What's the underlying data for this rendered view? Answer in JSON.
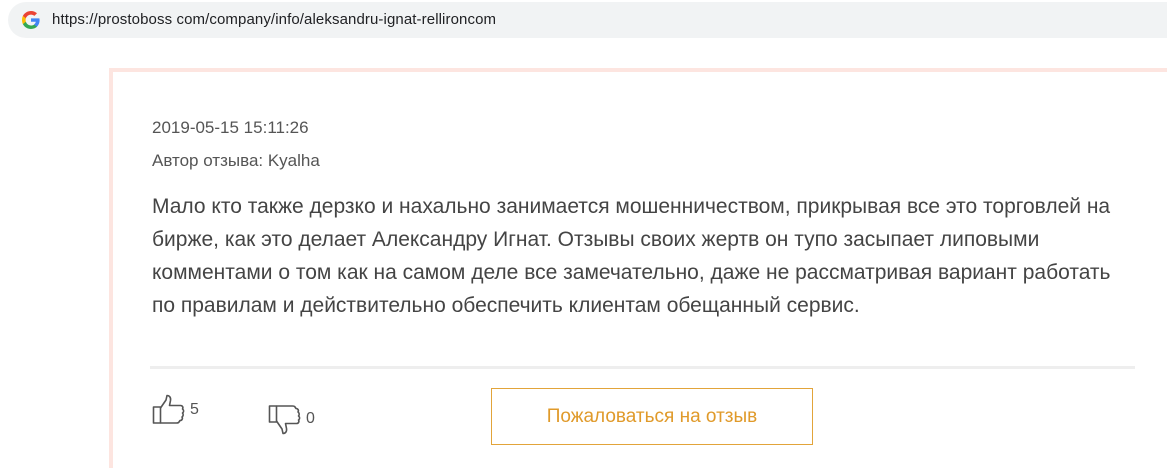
{
  "browser": {
    "url": "https://prostoboss com/company/info/aleksandru-ignat-rellironcom",
    "favicon": "google-g-icon"
  },
  "review": {
    "date": "2019-05-15 15:11:26",
    "author": "Автор отзыва: Kyalha",
    "text": "Мало кто также дерзко и нахально занимается мошенничеством, прикрывая все это торговлей на бирже, как это делает Александру Игнат. Отзывы своих жертв он тупо засыпает липовыми комментами о том как на самом деле все замечательно, даже не рассматривая вариант работать по правилам и действительно обеспечить клиентам обещанный сервис.",
    "likes": "5",
    "dislikes": "0",
    "complain_label": "Пожаловаться на отзыв"
  },
  "colors": {
    "accent": "#e09a2a",
    "card_border": "#fde5e0",
    "text": "#444444"
  }
}
